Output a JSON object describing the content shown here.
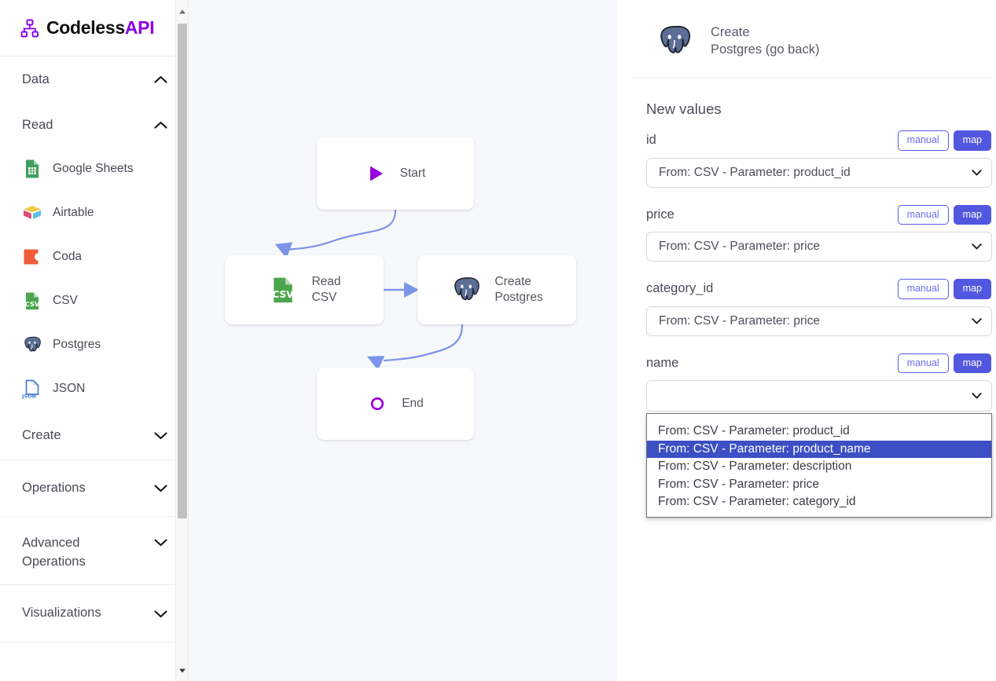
{
  "brand": {
    "name_primary": "Codeless",
    "name_accent": "API",
    "accent_color": "#8b00e8",
    "logo_icon": "sitemap-icon"
  },
  "sidebar": {
    "sections": [
      {
        "id": "data",
        "label": "Data",
        "chevron": "chevron-up-icon",
        "expanded": true
      },
      {
        "id": "read",
        "label": "Read",
        "chevron": "chevron-up-icon",
        "expanded": true
      },
      {
        "id": "create",
        "label": "Create",
        "chevron": "chevron-down-icon",
        "expanded": false
      },
      {
        "id": "operations",
        "label": "Operations",
        "chevron": "chevron-down-icon",
        "expanded": false
      },
      {
        "id": "advanced-operations",
        "label": "Advanced Operations",
        "chevron": "chevron-down-icon",
        "expanded": false
      },
      {
        "id": "visualizations",
        "label": "Visualizations",
        "chevron": "chevron-down-icon",
        "expanded": false
      }
    ],
    "read_items": [
      {
        "id": "google-sheets",
        "label": "Google Sheets",
        "icon": "google-sheets-icon",
        "color": "#3f9f5b"
      },
      {
        "id": "airtable",
        "label": "Airtable",
        "icon": "airtable-icon",
        "color": "#f2c94c"
      },
      {
        "id": "coda",
        "label": "Coda",
        "icon": "coda-icon",
        "color": "#ef5c3a"
      },
      {
        "id": "csv",
        "label": "CSV",
        "icon": "csv-file-icon",
        "color": "#4ca64c"
      },
      {
        "id": "postgres",
        "label": "Postgres",
        "icon": "postgres-elephant-icon",
        "color": "#5b6e96"
      },
      {
        "id": "json",
        "label": "JSON",
        "icon": "json-file-icon",
        "color": "#3b7fd4"
      }
    ]
  },
  "canvas": {
    "background_color": "#f7f8fb",
    "edge_color": "#7b93e8",
    "nodes": [
      {
        "id": "start",
        "label": "Start",
        "icon": "play-triangle-icon",
        "icon_color": "#9500e0"
      },
      {
        "id": "read",
        "label": "Read\nCSV",
        "icon": "csv-file-icon",
        "icon_color": "#4ca64c"
      },
      {
        "id": "create",
        "label": "Create\nPostgres",
        "icon": "postgres-elephant-icon",
        "icon_color": "#5b6e96"
      },
      {
        "id": "end",
        "label": "End",
        "icon": "circle-outline-icon",
        "icon_color": "#9500e0"
      }
    ]
  },
  "panel": {
    "header": {
      "icon": "postgres-elephant-icon",
      "title": "Create\nPostgres (go back)",
      "go_back_label": "(go back)"
    },
    "section_title": "New values",
    "mode_buttons": {
      "manual": "manual",
      "map": "map"
    },
    "fields": [
      {
        "id": "id",
        "name": "id",
        "mode": "map",
        "value": "From: CSV - Parameter: product_id",
        "open": false
      },
      {
        "id": "price",
        "name": "price",
        "mode": "map",
        "value": "From: CSV - Parameter: price",
        "open": false
      },
      {
        "id": "category_id",
        "name": "category_id",
        "mode": "map",
        "value": "From: CSV - Parameter: price",
        "open": false
      },
      {
        "id": "name",
        "name": "name",
        "mode": "map",
        "value": "",
        "open": true
      }
    ],
    "dropdown": {
      "options": [
        "From: CSV - Parameter: product_id",
        "From: CSV - Parameter: product_name",
        "From: CSV - Parameter: description",
        "From: CSV - Parameter: price",
        "From: CSV - Parameter: category_id"
      ],
      "selected_index": 1,
      "highlight_color": "#3c4fc4"
    }
  }
}
